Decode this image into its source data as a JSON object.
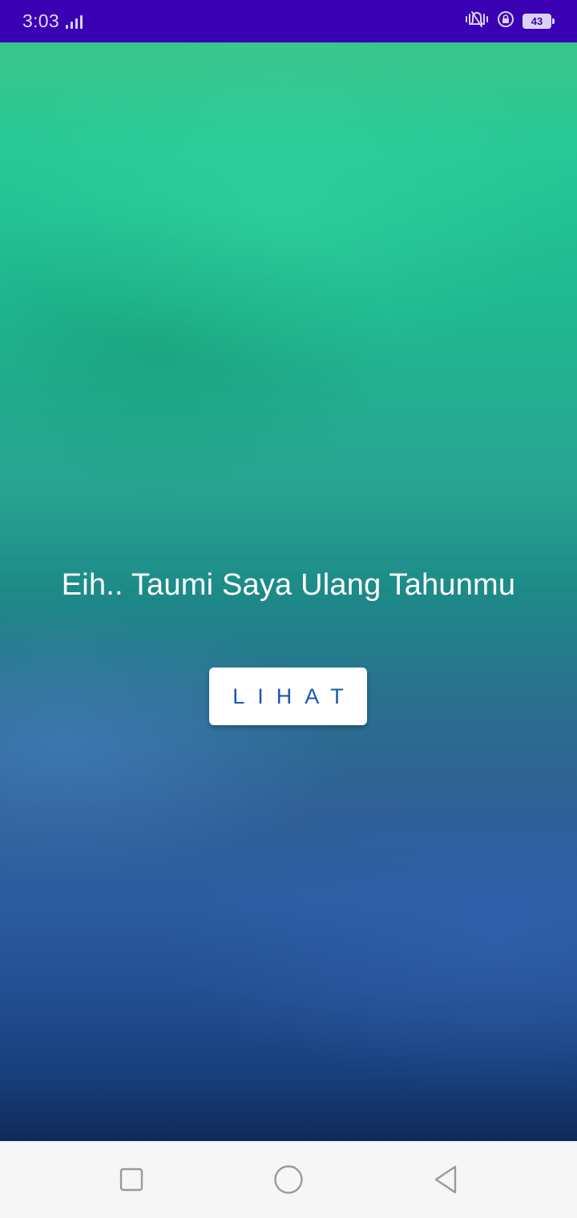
{
  "status_bar": {
    "time": "3:03",
    "battery_level": "43",
    "icons": [
      "signal-icon",
      "vibrate-icon",
      "rotation-lock-icon",
      "battery-icon"
    ]
  },
  "main": {
    "title": "Eih.. Taumi Saya Ulang Tahunmu",
    "button_label": "LIHAT"
  },
  "nav_bar": {
    "buttons": [
      "recent-apps-icon",
      "home-icon",
      "back-icon"
    ]
  },
  "colors": {
    "status_bar_bg": "#3a00b4",
    "button_text": "#1b58a8",
    "title_text": "#ffffff"
  }
}
